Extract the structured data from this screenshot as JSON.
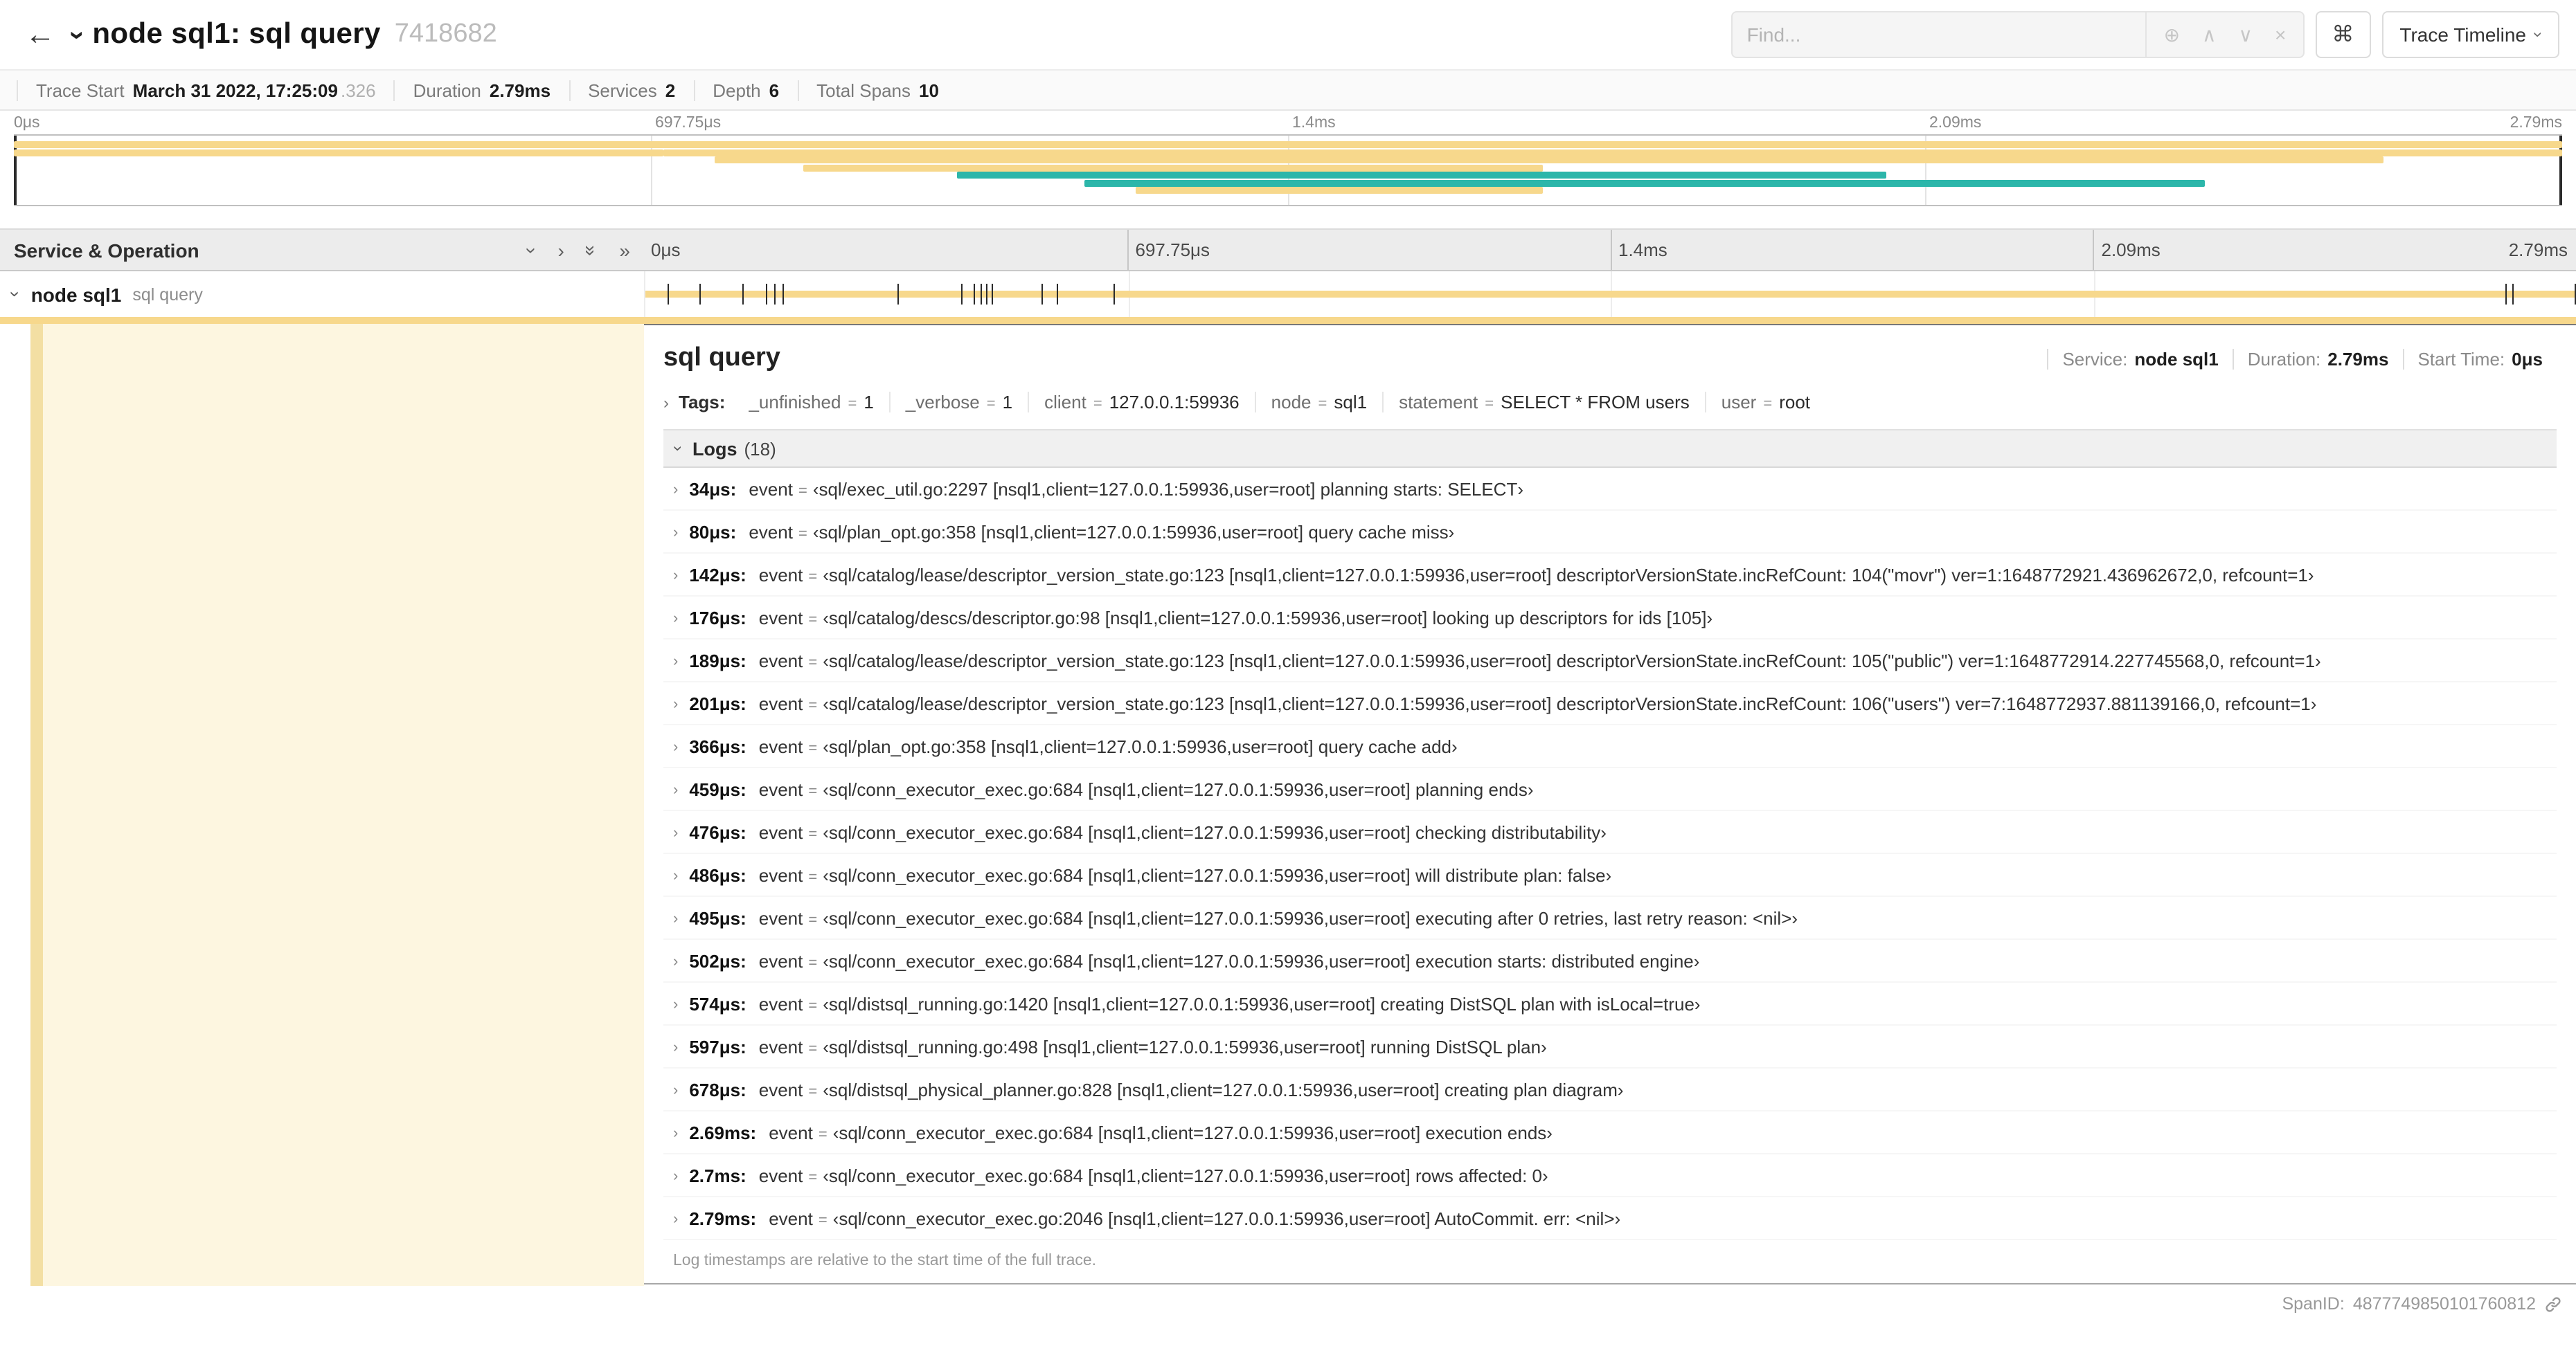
{
  "colors": {
    "tan": "#f7d88c",
    "teal": "#2cb6aa",
    "pale": "#fdf6e0",
    "stripe": "#f3dfa3"
  },
  "header": {
    "back_icon": "←",
    "title": "node sql1: sql query",
    "trace_id": "7418682",
    "find_placeholder": "Find...",
    "zoom_icon": "⊕",
    "prev_icon": "∧",
    "next_icon": "∨",
    "clear_icon": "×",
    "cmd_label": "⌘",
    "view_button": "Trace Timeline"
  },
  "summary": {
    "items": [
      {
        "label": "Trace Start",
        "value": "March 31 2022, 17:25:09",
        "suffix": ".326"
      },
      {
        "label": "Duration",
        "value": "2.79ms"
      },
      {
        "label": "Services",
        "value": "2"
      },
      {
        "label": "Depth",
        "value": "6"
      },
      {
        "label": "Total Spans",
        "value": "10"
      }
    ]
  },
  "timeline": {
    "ticks": [
      "0μs",
      "697.75μs",
      "1.4ms",
      "2.09ms",
      "2.79ms"
    ]
  },
  "minimap": {
    "bars": [
      {
        "row": 0,
        "start": 0,
        "end": 100,
        "color": "tan"
      },
      {
        "row": 1,
        "start": 0,
        "end": 25.5,
        "color": "tan"
      },
      {
        "row": 1,
        "start": 25.5,
        "end": 100,
        "color": "tan"
      },
      {
        "row": 2,
        "start": 27.5,
        "end": 93,
        "color": "tan"
      },
      {
        "row": 3,
        "start": 31,
        "end": 60,
        "color": "tan"
      },
      {
        "row": 4,
        "start": 37,
        "end": 73.5,
        "color": "teal"
      },
      {
        "row": 5,
        "start": 42,
        "end": 86,
        "color": "teal"
      },
      {
        "row": 6,
        "start": 44,
        "end": 60,
        "color": "tan"
      }
    ]
  },
  "left_panel": {
    "header": "Service & Operation"
  },
  "span_row": {
    "service": "node sql1",
    "operation": "sql query"
  },
  "trace": {
    "duration_us": 2790
  },
  "detail": {
    "title": "sql query",
    "meta": [
      {
        "label": "Service:",
        "value": "node sql1"
      },
      {
        "label": "Duration:",
        "value": "2.79ms"
      },
      {
        "label": "Start Time:",
        "value": "0μs"
      }
    ],
    "tags_label": "Tags:",
    "eq": "=",
    "tags": [
      {
        "key": "_unfinished",
        "value": "1"
      },
      {
        "key": "_verbose",
        "value": "1"
      },
      {
        "key": "client",
        "value": "127.0.0.1:59936"
      },
      {
        "key": "node",
        "value": "sql1"
      },
      {
        "key": "statement",
        "value": "SELECT * FROM users"
      },
      {
        "key": "user",
        "value": "root"
      }
    ],
    "logs_label": "Logs",
    "logs_count": "(18)",
    "field_label": "event",
    "logs": [
      {
        "time": "34μs:",
        "t_us": 34,
        "text": "‹sql/exec_util.go:2297 [nsql1,client=127.0.0.1:59936,user=root] planning starts: SELECT›"
      },
      {
        "time": "80μs:",
        "t_us": 80,
        "text": "‹sql/plan_opt.go:358 [nsql1,client=127.0.0.1:59936,user=root] query cache miss›"
      },
      {
        "time": "142μs:",
        "t_us": 142,
        "text": "‹sql/catalog/lease/descriptor_version_state.go:123 [nsql1,client=127.0.0.1:59936,user=root] descriptorVersionState.incRefCount: 104(\"movr\") ver=1:1648772921.436962672,0, refcount=1›"
      },
      {
        "time": "176μs:",
        "t_us": 176,
        "text": "‹sql/catalog/descs/descriptor.go:98 [nsql1,client=127.0.0.1:59936,user=root] looking up descriptors for ids [105]›"
      },
      {
        "time": "189μs:",
        "t_us": 189,
        "text": "‹sql/catalog/lease/descriptor_version_state.go:123 [nsql1,client=127.0.0.1:59936,user=root] descriptorVersionState.incRefCount: 105(\"public\") ver=1:1648772914.227745568,0, refcount=1›"
      },
      {
        "time": "201μs:",
        "t_us": 201,
        "text": "‹sql/catalog/lease/descriptor_version_state.go:123 [nsql1,client=127.0.0.1:59936,user=root] descriptorVersionState.incRefCount: 106(\"users\") ver=7:1648772937.881139166,0, refcount=1›"
      },
      {
        "time": "366μs:",
        "t_us": 366,
        "text": "‹sql/plan_opt.go:358 [nsql1,client=127.0.0.1:59936,user=root] query cache add›"
      },
      {
        "time": "459μs:",
        "t_us": 459,
        "text": "‹sql/conn_executor_exec.go:684 [nsql1,client=127.0.0.1:59936,user=root] planning ends›"
      },
      {
        "time": "476μs:",
        "t_us": 476,
        "text": "‹sql/conn_executor_exec.go:684 [nsql1,client=127.0.0.1:59936,user=root] checking distributability›"
      },
      {
        "time": "486μs:",
        "t_us": 486,
        "text": "‹sql/conn_executor_exec.go:684 [nsql1,client=127.0.0.1:59936,user=root] will distribute plan: false›"
      },
      {
        "time": "495μs:",
        "t_us": 495,
        "text": "‹sql/conn_executor_exec.go:684 [nsql1,client=127.0.0.1:59936,user=root] executing after 0 retries, last retry reason: <nil>›"
      },
      {
        "time": "502μs:",
        "t_us": 502,
        "text": "‹sql/conn_executor_exec.go:684 [nsql1,client=127.0.0.1:59936,user=root] execution starts: distributed engine›"
      },
      {
        "time": "574μs:",
        "t_us": 574,
        "text": "‹sql/distsql_running.go:1420 [nsql1,client=127.0.0.1:59936,user=root] creating DistSQL plan with isLocal=true›"
      },
      {
        "time": "597μs:",
        "t_us": 597,
        "text": "‹sql/distsql_running.go:498 [nsql1,client=127.0.0.1:59936,user=root] running DistSQL plan›"
      },
      {
        "time": "678μs:",
        "t_us": 678,
        "text": "‹sql/distsql_physical_planner.go:828 [nsql1,client=127.0.0.1:59936,user=root] creating plan diagram›"
      },
      {
        "time": "2.69ms:",
        "t_us": 2690,
        "text": "‹sql/conn_executor_exec.go:684 [nsql1,client=127.0.0.1:59936,user=root] execution ends›"
      },
      {
        "time": "2.7ms:",
        "t_us": 2700,
        "text": "‹sql/conn_executor_exec.go:684 [nsql1,client=127.0.0.1:59936,user=root] rows affected: 0›"
      },
      {
        "time": "2.79ms:",
        "t_us": 2790,
        "text": "‹sql/conn_executor_exec.go:2046 [nsql1,client=127.0.0.1:59936,user=root] AutoCommit. err: <nil>›"
      }
    ],
    "footer": "Log timestamps are relative to the start time of the full trace.",
    "spanid_label": "SpanID:",
    "spanid": "4877749850101760812"
  }
}
